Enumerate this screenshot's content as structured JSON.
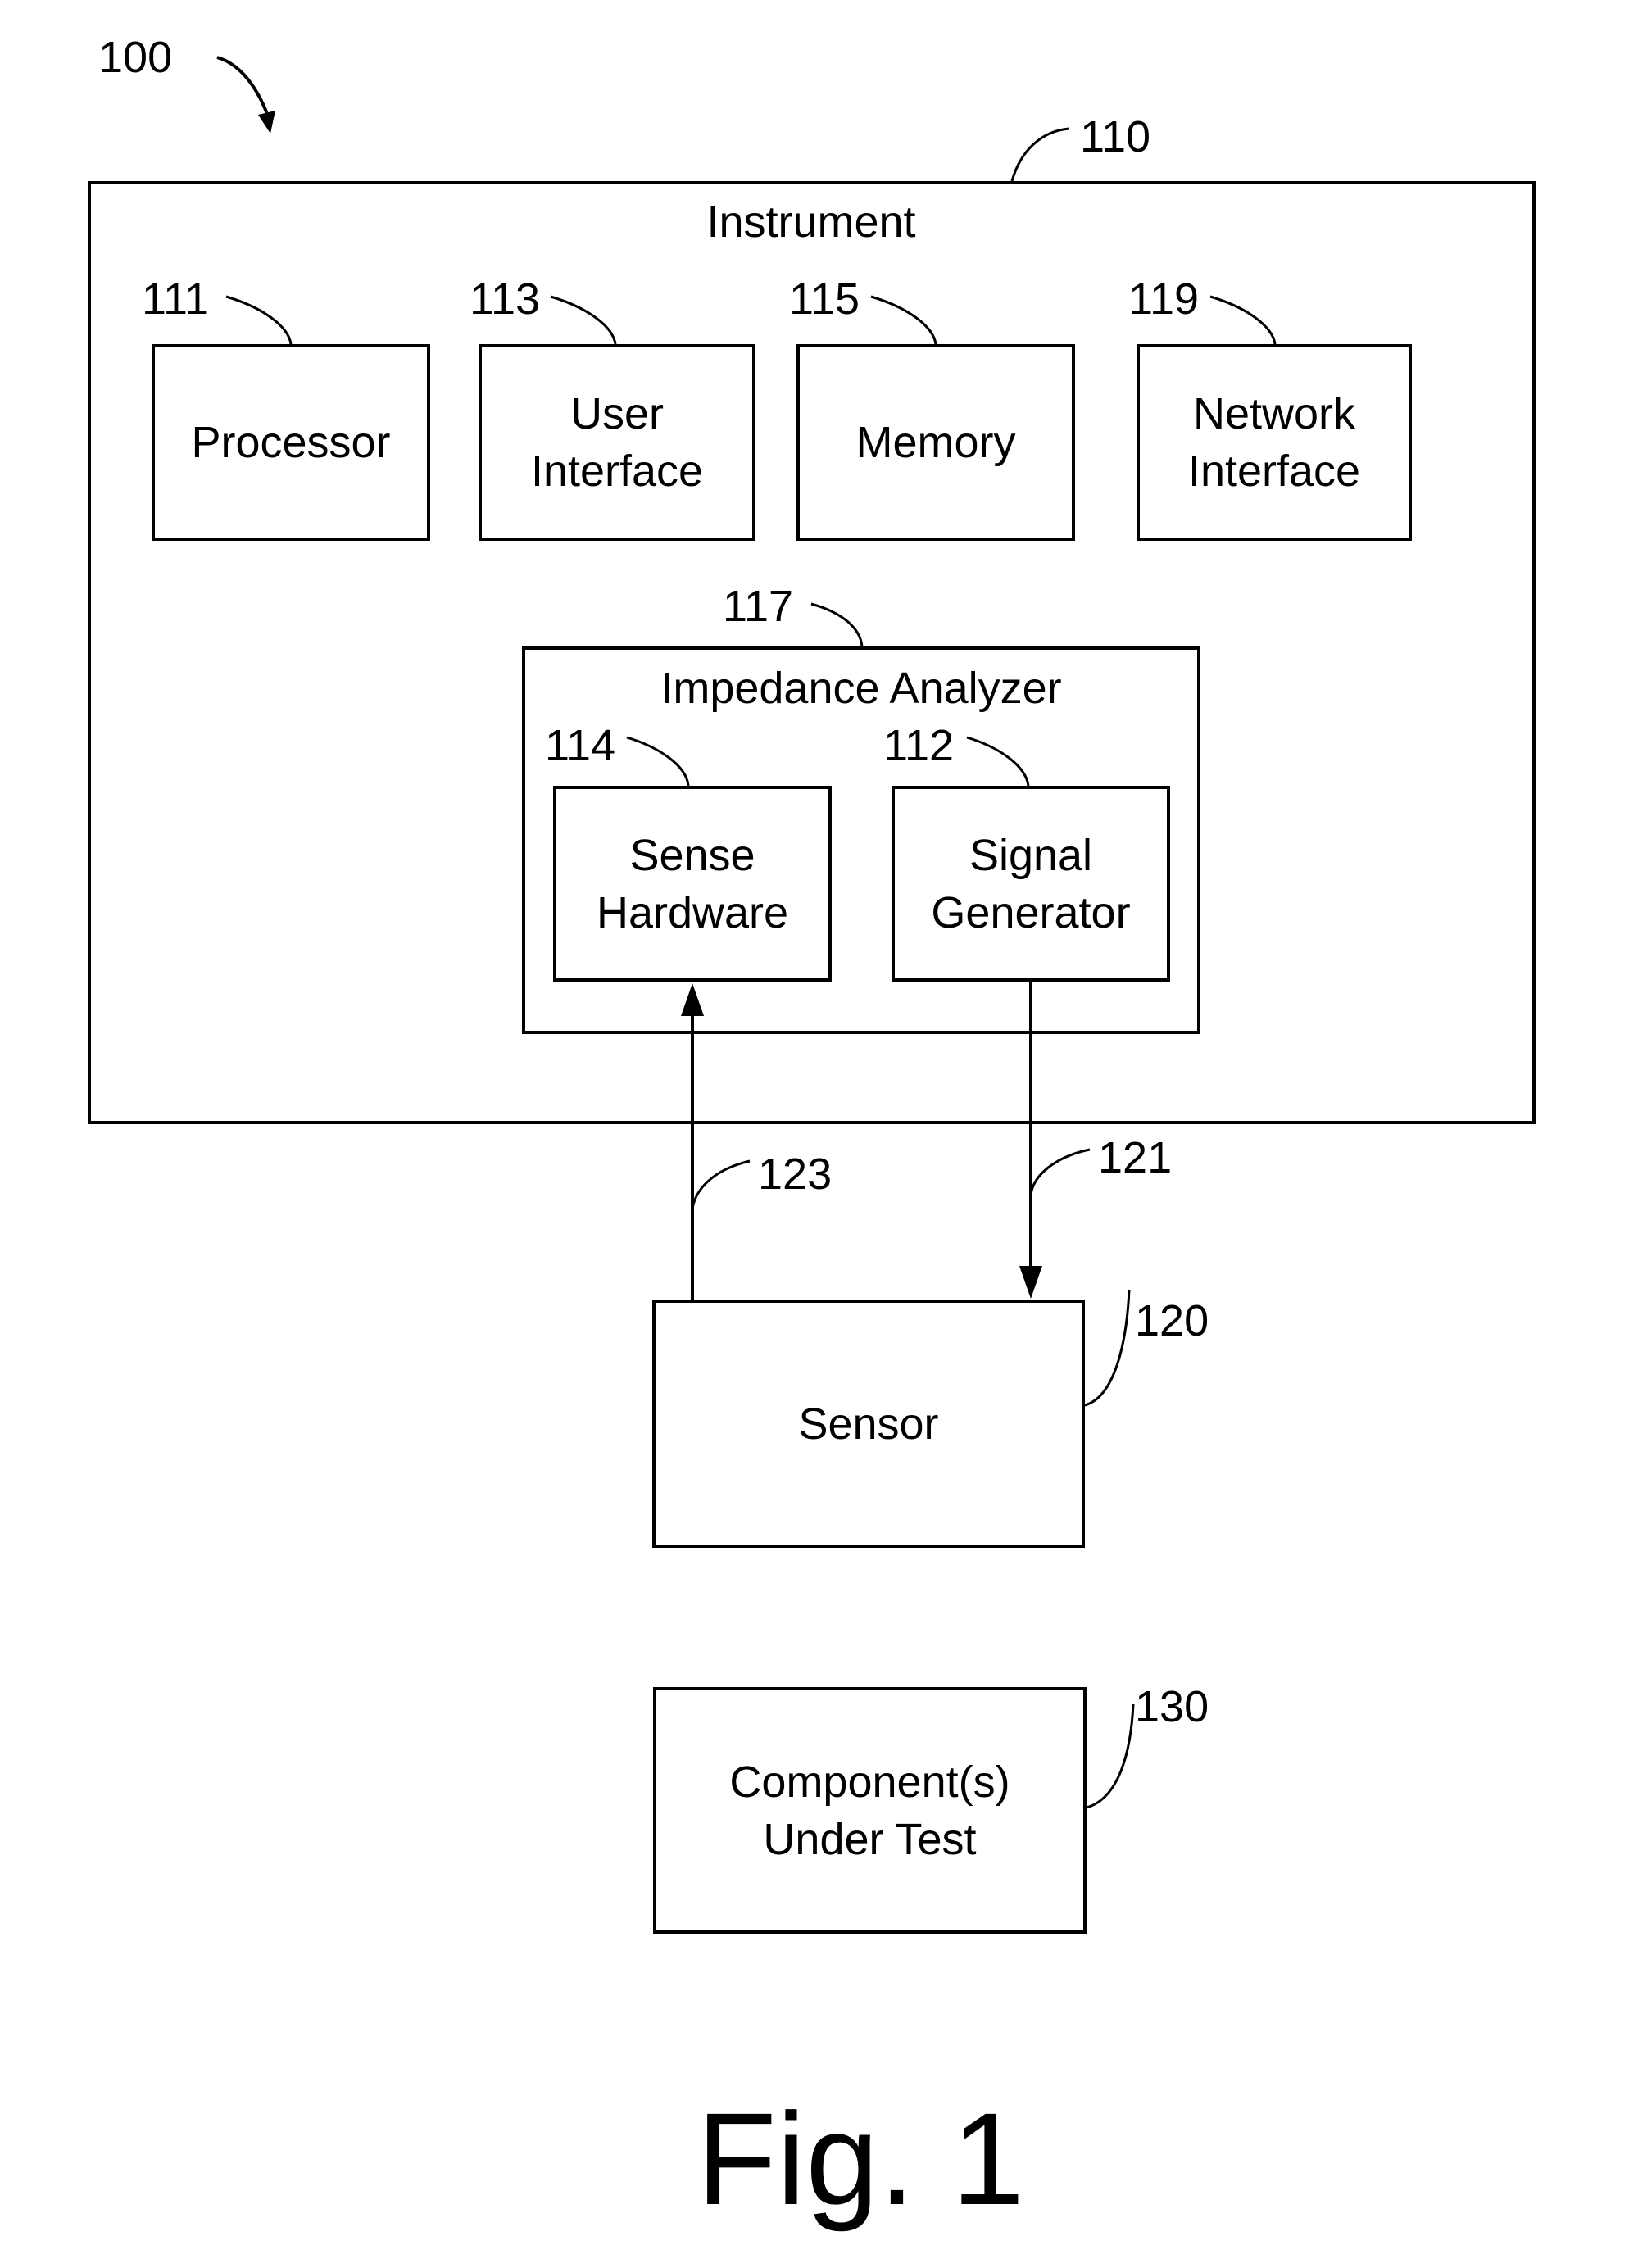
{
  "diagram": {
    "system_ref": "100",
    "instrument": {
      "ref": "110",
      "title": "Instrument"
    },
    "blocks": {
      "processor": {
        "ref": "111",
        "label": "Processor"
      },
      "user_interface": {
        "ref": "113",
        "label": "User\nInterface"
      },
      "memory": {
        "ref": "115",
        "label": "Memory"
      },
      "network_interface": {
        "ref": "119",
        "label": "Network\nInterface"
      },
      "impedance_analyzer": {
        "ref": "117",
        "title": "Impedance Analyzer"
      },
      "sense_hardware": {
        "ref": "114",
        "label": "Sense\nHardware"
      },
      "signal_generator": {
        "ref": "112",
        "label": "Signal\nGenerator"
      },
      "sensor": {
        "ref": "120",
        "label": "Sensor"
      },
      "component_under_test": {
        "ref": "130",
        "label": "Component(s)\nUnder Test"
      }
    },
    "connections": {
      "sensor_to_sense": {
        "ref": "123"
      },
      "generator_to_sensor": {
        "ref": "121"
      }
    },
    "caption": "Fig. 1"
  }
}
